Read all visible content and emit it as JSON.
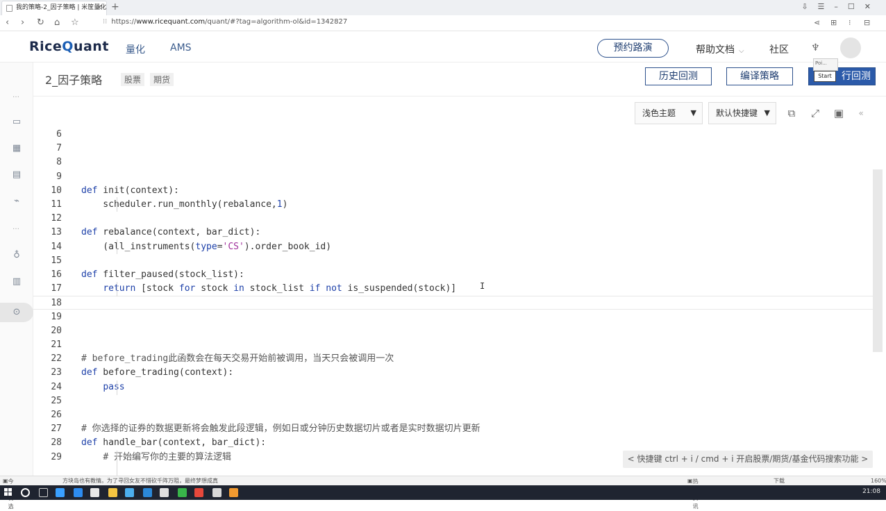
{
  "browser": {
    "tab_title": "我的策略-2_因子策略 | 米筐量化",
    "new_tab": "+",
    "url_prefix": "https://",
    "url_domain": "www.ricequant.com",
    "url_path": "/quant/#?tag=algorithm-ol&id=1342827"
  },
  "site": {
    "logo_left": "Rice",
    "logo_right": "uant",
    "logo_q": "Q",
    "nav": [
      "量化",
      "AMS"
    ],
    "roadshow_button": "预约路演",
    "help_docs": "帮助文档",
    "community": "社区"
  },
  "strategy": {
    "title": "2_因子策略",
    "tags": [
      "股票",
      "期货"
    ],
    "history_backtest": "历史回测",
    "compile": "编译策略",
    "run_backtest": "行回测"
  },
  "toolbar": {
    "theme": "浅色主题",
    "keymap": "默认快捷键"
  },
  "code_lines": [
    {
      "n": "6",
      "html": ""
    },
    {
      "n": "7",
      "html": ""
    },
    {
      "n": "8",
      "html": ""
    },
    {
      "n": "9",
      "html": ""
    },
    {
      "n": "10",
      "html": "<span class=\"kw\">def</span> init(context):"
    },
    {
      "n": "11",
      "html": "    scheduler.run_monthly(rebalance,<span class=\"num\">1</span>)"
    },
    {
      "n": "12",
      "html": ""
    },
    {
      "n": "13",
      "html": "<span class=\"kw\">def</span> rebalance(context, bar_dict):"
    },
    {
      "n": "14",
      "html": "    (all_instruments(<span class=\"kw\">type</span>=<span class=\"str\">'CS'</span>).order_book_id)"
    },
    {
      "n": "15",
      "html": ""
    },
    {
      "n": "16",
      "html": "<span class=\"kw\">def</span> filter_paused(stock_list):"
    },
    {
      "n": "17",
      "html": "    <span class=\"kw\">return</span> [stock <span class=\"kw\">for</span> stock <span class=\"kw\">in</span> stock_list <span class=\"kw\">if</span> <span class=\"kw\">not</span> is_suspended(stock)]"
    },
    {
      "n": "18",
      "html": ""
    },
    {
      "n": "19",
      "html": ""
    },
    {
      "n": "20",
      "html": ""
    },
    {
      "n": "21",
      "html": ""
    },
    {
      "n": "22",
      "html": "<span class=\"cm\"># before_trading此函数会在每天交易开始前被调用，当天只会被调用一次</span>"
    },
    {
      "n": "23",
      "html": "<span class=\"kw\">def</span> before_trading(context):"
    },
    {
      "n": "24",
      "html": "    <span class=\"kw\">pass</span>"
    },
    {
      "n": "25",
      "html": ""
    },
    {
      "n": "26",
      "html": ""
    },
    {
      "n": "27",
      "html": "<span class=\"cm\"># 你选择的证券的数据更新将会触发此段逻辑，例如日或分钟历史数据切片或者是实时数据切片更新</span>"
    },
    {
      "n": "28",
      "html": "<span class=\"kw\">def</span> handle_bar(context, bar_dict):"
    },
    {
      "n": "29",
      "html": "    <span class=\"cm\"># 开始编写你的主要的算法逻辑</span>"
    }
  ],
  "hint": "< 快捷键 ctrl + i / cmd + i 开启股票/期货/基金代码搜索功能 >",
  "statusbar": {
    "left": "今日优选",
    "news": "方块岛也有教情。为了寻回女友不惜砍千阵万阻，最终梦想成真",
    "hot": "热点资讯",
    "download": "下载",
    "zoom": "160%"
  },
  "clock": "21:08",
  "tooltip": {
    "small": "Poi...",
    "start": "Start"
  }
}
